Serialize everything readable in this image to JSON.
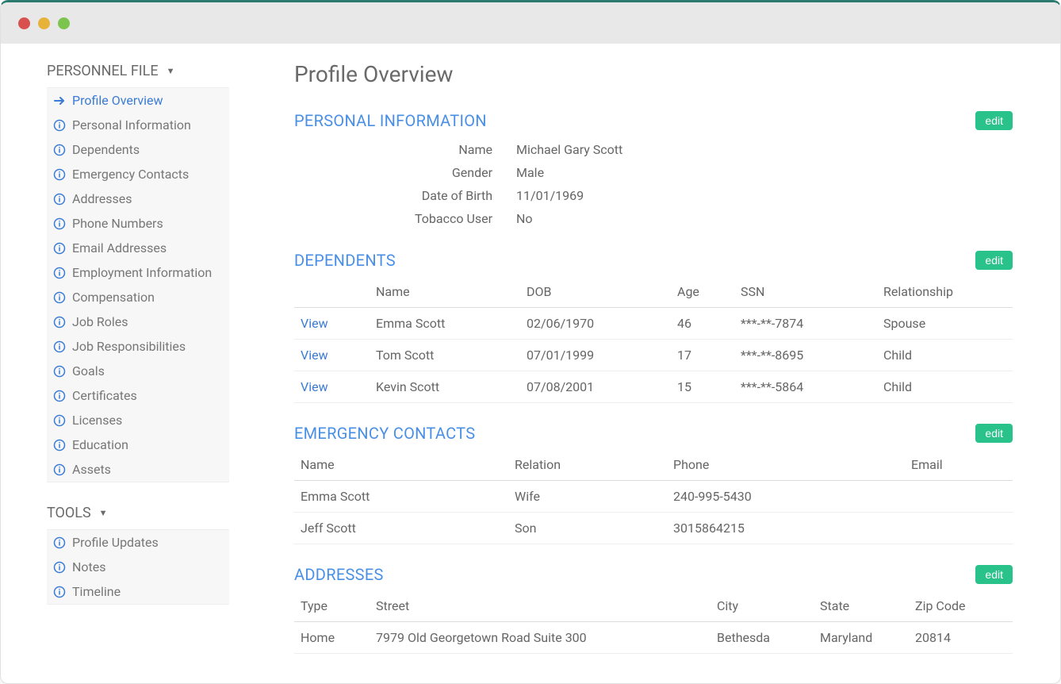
{
  "sidebar": {
    "groups": [
      {
        "title": "PERSONNEL FILE",
        "items": [
          {
            "label": "Profile Overview",
            "icon": "arrow",
            "active": true
          },
          {
            "label": "Personal Information",
            "icon": "info"
          },
          {
            "label": "Dependents",
            "icon": "info"
          },
          {
            "label": "Emergency Contacts",
            "icon": "info"
          },
          {
            "label": "Addresses",
            "icon": "info"
          },
          {
            "label": "Phone Numbers",
            "icon": "info"
          },
          {
            "label": "Email Addresses",
            "icon": "info"
          },
          {
            "label": "Employment Information",
            "icon": "info"
          },
          {
            "label": "Compensation",
            "icon": "info"
          },
          {
            "label": "Job Roles",
            "icon": "info"
          },
          {
            "label": "Job Responsibilities",
            "icon": "info"
          },
          {
            "label": "Goals",
            "icon": "info"
          },
          {
            "label": "Certificates",
            "icon": "info"
          },
          {
            "label": "Licenses",
            "icon": "info"
          },
          {
            "label": "Education",
            "icon": "info"
          },
          {
            "label": "Assets",
            "icon": "info"
          }
        ]
      },
      {
        "title": "TOOLS",
        "items": [
          {
            "label": "Profile Updates",
            "icon": "info"
          },
          {
            "label": "Notes",
            "icon": "info"
          },
          {
            "label": "Timeline",
            "icon": "info"
          }
        ]
      }
    ]
  },
  "main": {
    "title": "Profile Overview",
    "edit_label": "edit",
    "view_label": "View",
    "personal_info": {
      "title": "PERSONAL INFORMATION",
      "rows": [
        {
          "label": "Name",
          "value": "Michael Gary Scott"
        },
        {
          "label": "Gender",
          "value": "Male"
        },
        {
          "label": "Date of Birth",
          "value": "11/01/1969"
        },
        {
          "label": "Tobacco User",
          "value": "No"
        }
      ]
    },
    "dependents": {
      "title": "DEPENDENTS",
      "headers": [
        "",
        "Name",
        "DOB",
        "Age",
        "SSN",
        "Relationship"
      ],
      "rows": [
        {
          "name": "Emma Scott",
          "dob": "02/06/1970",
          "age": "46",
          "ssn": "***-**-7874",
          "rel": "Spouse"
        },
        {
          "name": "Tom Scott",
          "dob": "07/01/1999",
          "age": "17",
          "ssn": "***-**-8695",
          "rel": "Child"
        },
        {
          "name": "Kevin Scott",
          "dob": "07/08/2001",
          "age": "15",
          "ssn": "***-**-5864",
          "rel": "Child"
        }
      ]
    },
    "emergency": {
      "title": "EMERGENCY CONTACTS",
      "headers": [
        "Name",
        "Relation",
        "Phone",
        "Email"
      ],
      "rows": [
        {
          "name": "Emma Scott",
          "relation": "Wife",
          "phone": "240-995-5430",
          "email": ""
        },
        {
          "name": "Jeff Scott",
          "relation": "Son",
          "phone": "3015864215",
          "email": ""
        }
      ]
    },
    "addresses": {
      "title": "ADDRESSES",
      "headers": [
        "Type",
        "Street",
        "City",
        "State",
        "Zip Code"
      ],
      "rows": [
        {
          "type": "Home",
          "street": "7979 Old Georgetown Road Suite 300",
          "city": "Bethesda",
          "state": "Maryland",
          "zip": "20814"
        }
      ]
    }
  }
}
